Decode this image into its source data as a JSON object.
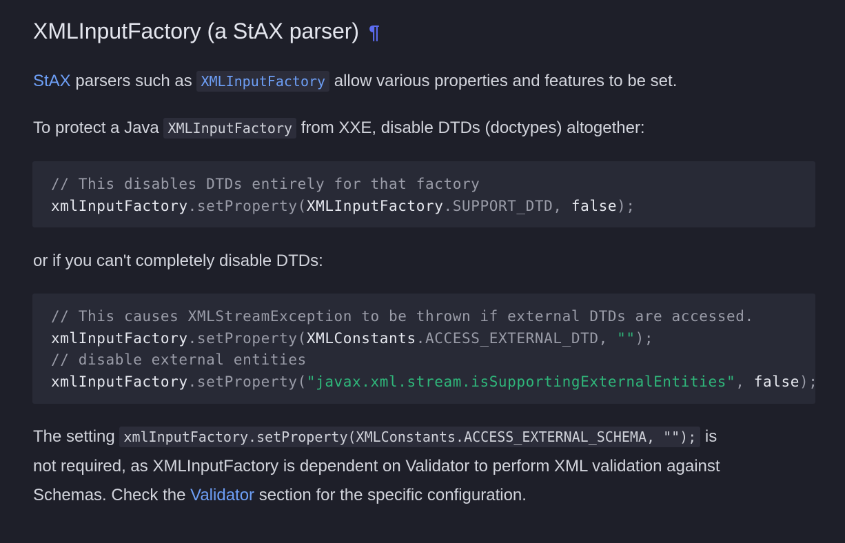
{
  "heading": {
    "text": "XMLInputFactory (a StAX parser)",
    "anchor": "¶"
  },
  "para1": {
    "link": "StAX",
    "text_a": " parsers such as ",
    "code": "XMLInputFactory",
    "text_b": " allow various properties and features to be set."
  },
  "para2": {
    "text_a": "To protect a Java ",
    "code": "XMLInputFactory",
    "text_b": " from XXE, disable DTDs (doctypes) altogether:"
  },
  "code1": {
    "comment": "// This disables DTDs entirely for that factory",
    "l2_obj": "xmlInputFactory",
    "l2_method": ".setProperty(",
    "l2_arg1_cls": "XMLInputFactory",
    "l2_arg1_const": ".SUPPORT_DTD, ",
    "l2_arg2": "false",
    "l2_end": ");"
  },
  "para3": {
    "text": "or if you can't completely disable DTDs:"
  },
  "code2": {
    "comment1": "// This causes XMLStreamException to be thrown if external DTDs are accessed.",
    "l2_obj": "xmlInputFactory",
    "l2_method": ".setProperty(",
    "l2_arg1_cls": "XMLConstants",
    "l2_arg1_const": ".ACCESS_EXTERNAL_DTD, ",
    "l2_arg2": "\"\"",
    "l2_end": ");",
    "comment2": "// disable external entities",
    "l4_obj": "xmlInputFactory",
    "l4_method": ".setProperty(",
    "l4_arg1": "\"javax.xml.stream.isSupportingExternalEntities\"",
    "l4_sep": ", ",
    "l4_arg2": "false",
    "l4_end": ");"
  },
  "para4": {
    "text_a": "The setting ",
    "code": "xmlInputFactory.setProperty(XMLConstants.ACCESS_EXTERNAL_SCHEMA, \"\");",
    "text_b": " is",
    "line2": "not required, as XMLInputFactory is dependent on Validator to perform XML validation against",
    "line3_a": "Schemas. Check the ",
    "line3_link": "Validator",
    "line3_b": " section for the specific configuration."
  }
}
